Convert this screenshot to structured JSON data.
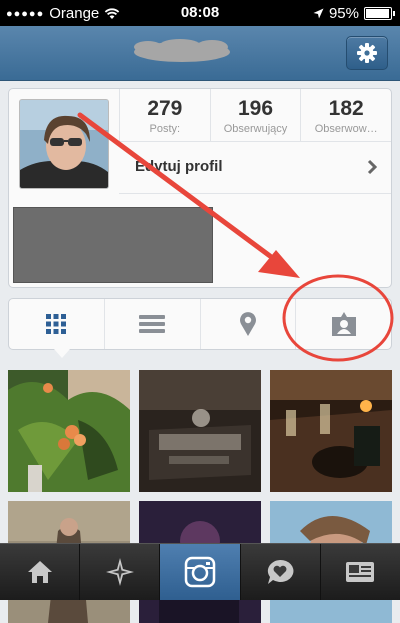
{
  "status_bar": {
    "carrier": "Orange",
    "time": "08:08",
    "battery": "95%",
    "battery_level": 0.95
  },
  "profile": {
    "stats": [
      {
        "value": "279",
        "label": "Posty:"
      },
      {
        "value": "196",
        "label": "Obserwujący"
      },
      {
        "value": "182",
        "label": "Obserwow…"
      }
    ],
    "edit_label": "Edytuj profil"
  },
  "view_tabs": [
    "grid",
    "list",
    "map",
    "tagged"
  ],
  "active_view_tab": "grid",
  "bottom_tabs": [
    "home",
    "explore",
    "camera",
    "activity",
    "profile"
  ],
  "active_bottom_tab": "camera",
  "colors": {
    "nav": "#3f6f98",
    "accent": "#2d5f95",
    "annotation": "#e8463b"
  }
}
